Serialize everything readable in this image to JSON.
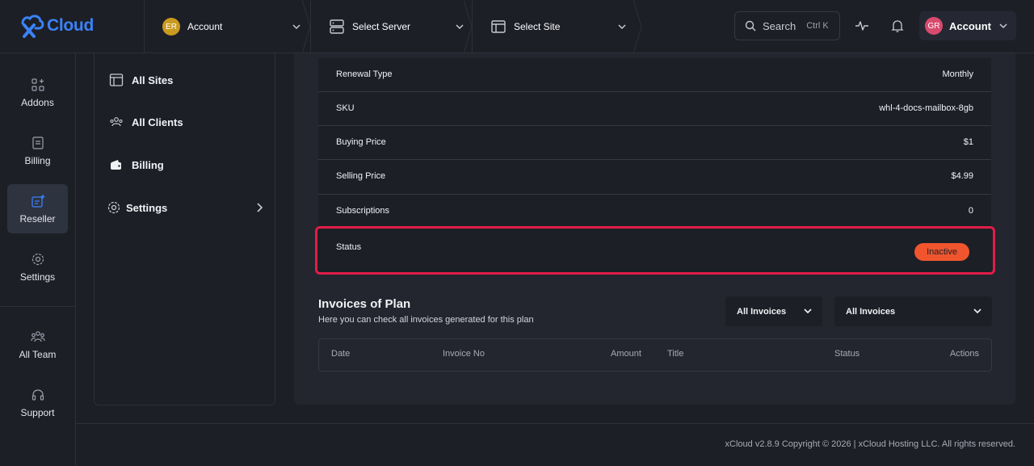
{
  "header": {
    "logo_text": "Cloud",
    "account_selector": {
      "avatar": "ER",
      "label": "Account"
    },
    "server_selector": {
      "label": "Select Server"
    },
    "site_selector": {
      "label": "Select Site"
    },
    "search": {
      "label": "Search",
      "shortcut": "Ctrl K"
    },
    "user": {
      "avatar": "GR",
      "label": "Account"
    }
  },
  "rail": {
    "items": [
      {
        "label": "Addons",
        "icon": "addons-icon"
      },
      {
        "label": "Billing",
        "icon": "billing-icon"
      },
      {
        "label": "Reseller",
        "icon": "reseller-icon",
        "active": true
      },
      {
        "label": "Settings",
        "icon": "settings-icon"
      },
      {
        "label": "All Team",
        "icon": "team-icon"
      },
      {
        "label": "Support",
        "icon": "support-icon"
      }
    ]
  },
  "submenu": {
    "items": [
      {
        "label": "All Sites",
        "icon": "sites-icon"
      },
      {
        "label": "All Clients",
        "icon": "clients-icon"
      },
      {
        "label": "Billing",
        "icon": "wallet-icon"
      },
      {
        "label": "Settings",
        "icon": "gear-icon"
      }
    ]
  },
  "details": {
    "rows": [
      {
        "label": "Renewal Type",
        "value": "Monthly"
      },
      {
        "label": "SKU",
        "value": "whl-4-docs-mailbox-8gb"
      },
      {
        "label": "Buying Price",
        "value": "$1"
      },
      {
        "label": "Selling Price",
        "value": "$4.99"
      },
      {
        "label": "Subscriptions",
        "value": "0"
      }
    ],
    "status": {
      "label": "Status",
      "value": "Inactive"
    }
  },
  "invoices": {
    "title": "Invoices of Plan",
    "subtitle": "Here you can check all invoices generated for this plan",
    "filter1": "All Invoices",
    "filter2": "All Invoices",
    "columns": [
      "Date",
      "Invoice No",
      "Amount",
      "Title",
      "Status",
      "Actions"
    ]
  },
  "footer": {
    "copyright": "xCloud v2.8.9 Copyright © 2026 | xCloud Hosting LLC. All rights reserved."
  },
  "colors": {
    "accent": "#3b82f6",
    "danger": "#e11d48",
    "badge": "#f0552e"
  }
}
